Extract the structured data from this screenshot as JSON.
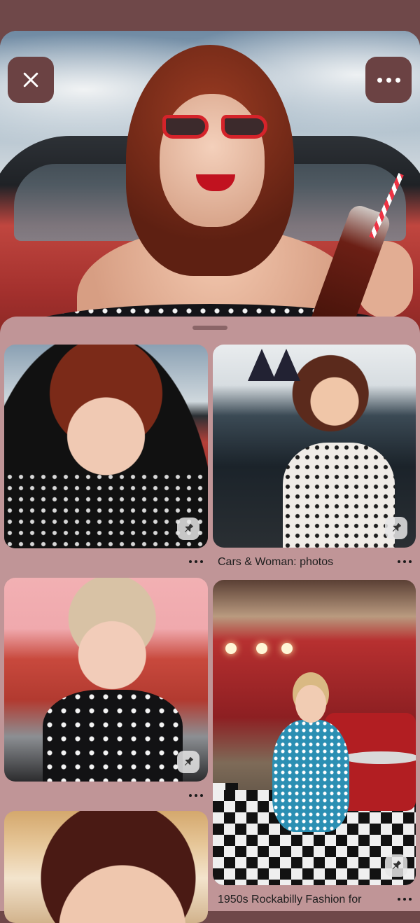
{
  "hero": {
    "close_icon": "close-icon",
    "more_icon": "more-horizontal-icon"
  },
  "pins": [
    {
      "caption": "",
      "badge_icon": "pin-icon"
    },
    {
      "caption": "Cars & Woman:  photos",
      "badge_icon": "pin-icon"
    },
    {
      "caption": "",
      "badge_icon": "pin-icon"
    },
    {
      "caption": "1950s Rockabilly Fashion for",
      "badge_icon": "pin-icon"
    },
    {
      "caption": "",
      "badge_icon": ""
    }
  ],
  "colors": {
    "background": "#6f4849",
    "sheet": "#c09597",
    "button": "#6b4243"
  }
}
